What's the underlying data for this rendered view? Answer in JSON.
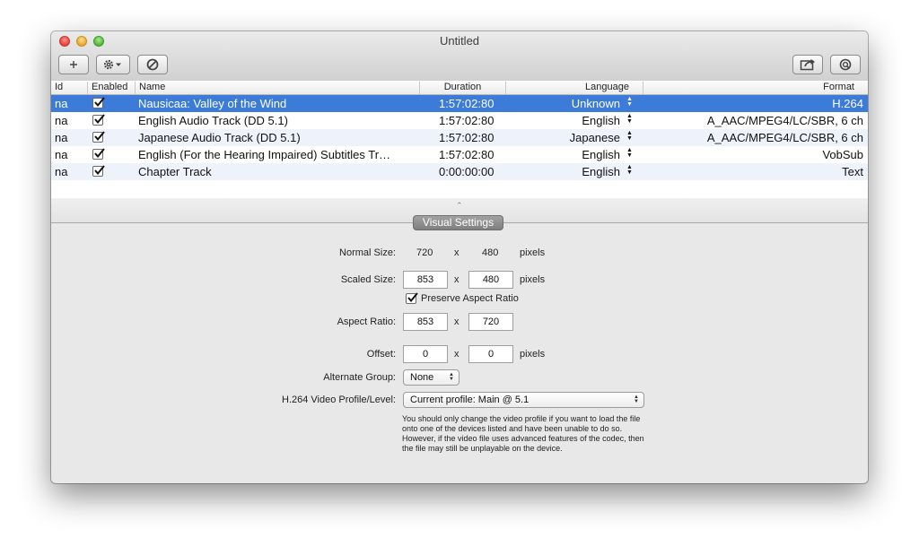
{
  "window": {
    "title": "Untitled"
  },
  "toolbar": {
    "add_icon": "plus-icon",
    "action_icon": "gear-icon",
    "disable_icon": "prohibit-icon",
    "share_icon": "share-icon",
    "inspect_icon": "inspect-icon"
  },
  "table": {
    "columns": [
      "Id",
      "Enabled",
      "Name",
      "Duration",
      "Language",
      "Format"
    ],
    "rows": [
      {
        "id": "na",
        "enabled": true,
        "name": "Nausicaa: Valley of the Wind",
        "duration": "1:57:02:80",
        "language": "Unknown",
        "format": "H.264",
        "selected": true
      },
      {
        "id": "na",
        "enabled": true,
        "name": "English Audio Track (DD 5.1)",
        "duration": "1:57:02:80",
        "language": "English",
        "format": "A_AAC/MPEG4/LC/SBR, 6 ch",
        "selected": false
      },
      {
        "id": "na",
        "enabled": true,
        "name": "Japanese Audio Track (DD 5.1)",
        "duration": "1:57:02:80",
        "language": "Japanese",
        "format": "A_AAC/MPEG4/LC/SBR, 6 ch",
        "selected": false
      },
      {
        "id": "na",
        "enabled": true,
        "name": "English (For the Hearing Impaired) Subtitles Tr…",
        "duration": "1:57:02:80",
        "language": "English",
        "format": "VobSub",
        "selected": false
      },
      {
        "id": "na",
        "enabled": true,
        "name": "Chapter Track",
        "duration": "0:00:00:00",
        "language": "English",
        "format": "Text",
        "selected": false
      }
    ]
  },
  "panel": {
    "tab_label": "Visual Settings",
    "normal_size": {
      "label": "Normal Size:",
      "width": "720",
      "sep": "x",
      "height": "480",
      "unit": "pixels"
    },
    "scaled_size": {
      "label": "Scaled Size:",
      "width": "853",
      "sep": "x",
      "height": "480",
      "unit": "pixels"
    },
    "preserve_aspect": {
      "label": "Preserve Aspect Ratio",
      "checked": true
    },
    "aspect_ratio": {
      "label": "Aspect Ratio:",
      "width": "853",
      "sep": "x",
      "height": "720"
    },
    "offset": {
      "label": "Offset:",
      "x": "0",
      "sep": "x",
      "y": "0",
      "unit": "pixels"
    },
    "alternate_group": {
      "label": "Alternate Group:",
      "value": "None"
    },
    "profile": {
      "label": "H.264 Video Profile/Level:",
      "value": "Current profile: Main @ 5.1"
    },
    "note": "You should only change the video profile if you want to load the file onto one of the devices listed and have been unable to do so.  However, if the video file uses advanced features of the codec, then the file may still be unplayable on the device."
  },
  "colors": {
    "selection": "#3c7bd7",
    "alt_row": "#eef3fb",
    "panel_tab": "#8e8e8e"
  }
}
